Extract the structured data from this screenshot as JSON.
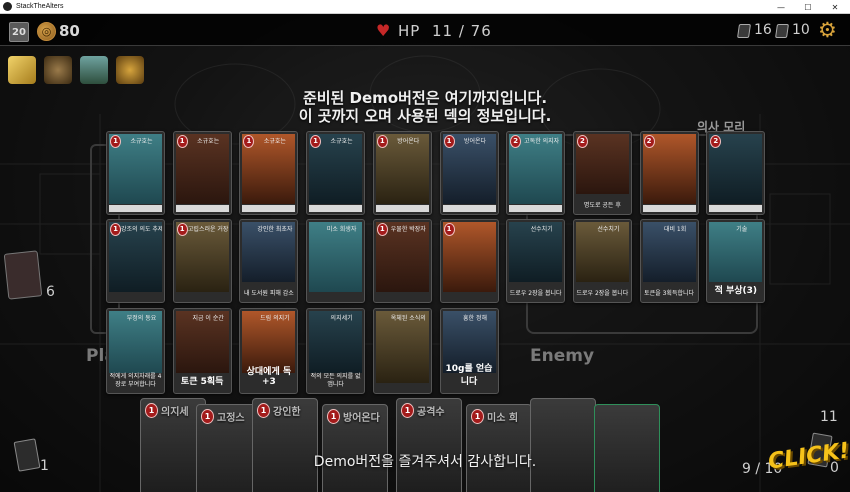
{
  "window": {
    "title": "StackTheAlters",
    "minimize": "—",
    "maximize": "☐",
    "close": "✕"
  },
  "hud": {
    "day": "20",
    "gold": "80",
    "hp_label": "HP",
    "hp_value": "11 / 76",
    "draw_pile_count": "16",
    "discard_pile_count": "10",
    "settings_icon": "gear-icon"
  },
  "relics": [
    "gold-bar-icon",
    "magnifier-icon",
    "jar-icon",
    "sword-shield-icon"
  ],
  "message": {
    "line1": "준비된 Demo버전은 여기까지입니다.",
    "line2": "이 곳까지 오며 사용된 덱의 정보입니다.",
    "thanks": "Demo버전을 즐겨주셔서 감사합니다."
  },
  "deck_rows": [
    [
      {
        "cost": "1",
        "name": "소규호는",
        "desc": "",
        "big": ""
      },
      {
        "cost": "1",
        "name": "소규호는",
        "desc": "",
        "big": ""
      },
      {
        "cost": "1",
        "name": "소규호는",
        "desc": "",
        "big": ""
      },
      {
        "cost": "1",
        "name": "소규호는",
        "desc": "",
        "big": ""
      },
      {
        "cost": "1",
        "name": "방어온다",
        "desc": "",
        "big": ""
      },
      {
        "cost": "1",
        "name": "방어온다",
        "desc": "",
        "big": ""
      },
      {
        "cost": "2",
        "name": "고독한 의지자",
        "desc": "",
        "big": ""
      },
      {
        "cost": "2",
        "name": "",
        "desc": "명도로 공든 후",
        "big": ""
      },
      {
        "cost": "2",
        "name": "",
        "desc": "",
        "big": ""
      },
      {
        "cost": "2",
        "name": "",
        "desc": "",
        "big": ""
      }
    ],
    [
      {
        "cost": "1",
        "name": "강조의 의도 추제",
        "desc": "",
        "big": ""
      },
      {
        "cost": "1",
        "name": "고립스러운 거장",
        "desc": "",
        "big": ""
      },
      {
        "cost": "",
        "name": "강인한 최초자",
        "desc": "내 도서원 피해 감소",
        "big": ""
      },
      {
        "cost": "",
        "name": "미소 희생자",
        "desc": "",
        "big": ""
      },
      {
        "cost": "1",
        "name": "우물한 박장자",
        "desc": "",
        "big": ""
      },
      {
        "cost": "1",
        "name": "",
        "desc": "",
        "big": ""
      },
      {
        "cost": "",
        "name": "선수치기",
        "desc": "드로우 2장을 봅니다",
        "big": ""
      },
      {
        "cost": "",
        "name": "선수치기",
        "desc": "드로우 2장을 봅니다",
        "big": ""
      },
      {
        "cost": "",
        "name": "대비 1회",
        "desc": "토큰을 3획득합니다",
        "big": ""
      },
      {
        "cost": "",
        "name": "기술",
        "desc": "",
        "big": "적 부상(3)"
      }
    ],
    [
      {
        "cost": "",
        "name": "부정의 동요",
        "desc": "적에게 의지자래를 4장로 부여합니다",
        "big": ""
      },
      {
        "cost": "",
        "name": "지금 이 순간",
        "desc": "",
        "big": "토큰 5획득"
      },
      {
        "cost": "",
        "name": "드림 의지기",
        "desc": "",
        "big": "상대에게 독+3"
      },
      {
        "cost": "",
        "name": "의지세기",
        "desc": "적의 모든 의지를 없앱니다",
        "big": ""
      },
      {
        "cost": "",
        "name": "옥체된 소식의",
        "desc": "",
        "big": ""
      },
      {
        "cost": "",
        "name": "흥한 정해",
        "desc": "",
        "big": "10g를 얻습니다"
      }
    ]
  ],
  "board": {
    "player_label": "Pla",
    "enemy_label": "Enemy",
    "enemy_header": "의사 모리",
    "left_pile_count": "6",
    "bottom_left_count": "1",
    "bottom_right_top_count": "11",
    "bottom_right_count": "9 / 10",
    "bottom_right_zero": "0",
    "click_label": "CLICK!"
  },
  "hand": [
    {
      "cost": "1",
      "name": "의지세"
    },
    {
      "cost": "1",
      "name": "고정스"
    },
    {
      "cost": "1",
      "name": "강인한"
    },
    {
      "cost": "1",
      "name": "방어온다"
    },
    {
      "cost": "1",
      "name": "공격수"
    },
    {
      "cost": "1",
      "name": "미소 희"
    },
    {
      "cost": "",
      "name": ""
    },
    {
      "cost": "",
      "name": ""
    }
  ],
  "colors": {
    "accent_gold": "#f6c21a",
    "hp_red": "#c62828",
    "cost_red": "#a31b1b",
    "card_teal": "#2f6b75"
  }
}
